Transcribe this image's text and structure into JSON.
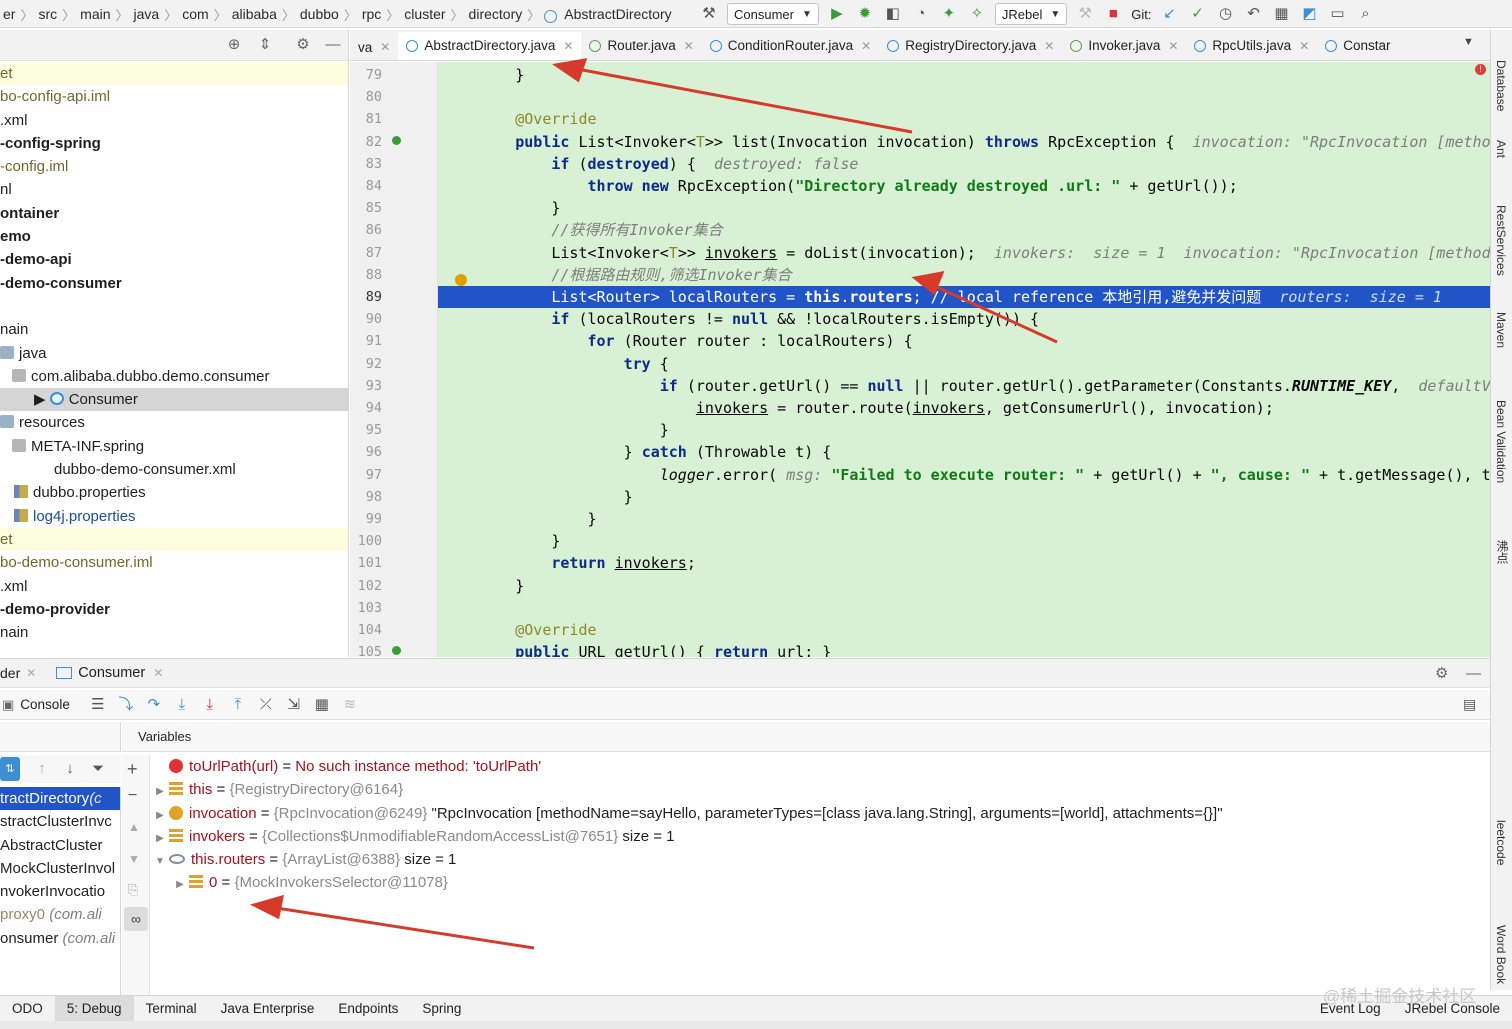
{
  "breadcrumbs": [
    "er",
    "src",
    "main",
    "java",
    "com",
    "alibaba",
    "dubbo",
    "rpc",
    "cluster",
    "directory",
    "AbstractDirectory"
  ],
  "toolbar": {
    "run_config": "Consumer",
    "jrebel": "JRebel",
    "git_label": "Git:"
  },
  "project_tree": [
    {
      "label": "et",
      "style": "olive alt"
    },
    {
      "label": "bo-config-api.iml",
      "style": "olive"
    },
    {
      "label": ".xml",
      "style": ""
    },
    {
      "label": "-config-spring",
      "style": "bold"
    },
    {
      "label": "-config.iml",
      "style": "olive"
    },
    {
      "label": "nl",
      "style": ""
    },
    {
      "label": "ontainer",
      "style": "bold"
    },
    {
      "label": "emo",
      "style": "bold"
    },
    {
      "label": "-demo-api",
      "style": "bold"
    },
    {
      "label": "-demo-consumer",
      "style": "bold"
    },
    {
      "label": "",
      "style": ""
    },
    {
      "label": "nain",
      "style": ""
    },
    {
      "label": "java",
      "style": "",
      "icon": "folder",
      "indent": 0
    },
    {
      "label": "com.alibaba.dubbo.demo.consumer",
      "style": "",
      "icon": "pkg",
      "indent": 12
    },
    {
      "label": "Consumer",
      "style": "sel",
      "icon": "cls",
      "indent": 34
    },
    {
      "label": "resources",
      "style": "",
      "icon": "folder",
      "indent": 0
    },
    {
      "label": "META-INF.spring",
      "style": "",
      "icon": "pkg",
      "indent": 12
    },
    {
      "label": "dubbo-demo-consumer.xml",
      "style": "",
      "indent": 54
    },
    {
      "label": "dubbo.properties",
      "style": "",
      "icon": "prop",
      "indent": 14
    },
    {
      "label": "log4j.properties",
      "style": "blue",
      "icon": "prop",
      "indent": 14
    },
    {
      "label": "et",
      "style": "olive alt"
    },
    {
      "label": "bo-demo-consumer.iml",
      "style": "olive"
    },
    {
      "label": ".xml",
      "style": ""
    },
    {
      "label": "-demo-provider",
      "style": "bold"
    },
    {
      "label": "nain",
      "style": ""
    }
  ],
  "editor_tabs": [
    {
      "label": "va",
      "kind": "plain"
    },
    {
      "label": "AbstractDirectory.java",
      "kind": "class",
      "active": true
    },
    {
      "label": "Router.java",
      "kind": "iface"
    },
    {
      "label": "ConditionRouter.java",
      "kind": "class"
    },
    {
      "label": "RegistryDirectory.java",
      "kind": "class"
    },
    {
      "label": "Invoker.java",
      "kind": "iface"
    },
    {
      "label": "RpcUtils.java",
      "kind": "class"
    },
    {
      "label": "Constar",
      "kind": "class",
      "truncated": true
    }
  ],
  "code": {
    "first_line": 79,
    "current_line": 89,
    "lines": [
      [
        {
          "t": "        }"
        }
      ],
      [
        {
          "t": ""
        }
      ],
      [
        {
          "t": "        "
        },
        {
          "t": "@Override",
          "c": "ann"
        }
      ],
      [
        {
          "t": "        "
        },
        {
          "t": "public",
          "c": "kw"
        },
        {
          "t": " List<Invoker<"
        },
        {
          "t": "T",
          "c": "ann"
        },
        {
          "t": ">> list(Invocation invocation) "
        },
        {
          "t": "throws",
          "c": "kw"
        },
        {
          "t": " RpcException {  "
        },
        {
          "t": "invocation: \"RpcInvocation [metho",
          "c": "hint"
        }
      ],
      [
        {
          "t": "            "
        },
        {
          "t": "if",
          "c": "kw"
        },
        {
          "t": " ("
        },
        {
          "t": "destroyed",
          "c": "kw"
        },
        {
          "t": ") {  "
        },
        {
          "t": "destroyed: false",
          "c": "hint"
        }
      ],
      [
        {
          "t": "                "
        },
        {
          "t": "throw new",
          "c": "kw"
        },
        {
          "t": " RpcException("
        },
        {
          "t": "\"Directory already destroyed .url: \"",
          "c": "str"
        },
        {
          "t": " + getUrl());"
        }
      ],
      [
        {
          "t": "            }"
        }
      ],
      [
        {
          "t": "            "
        },
        {
          "t": "//获得所有Invoker集合",
          "c": "cmt"
        }
      ],
      [
        {
          "t": "            List<Invoker<"
        },
        {
          "t": "T",
          "c": "ann"
        },
        {
          "t": ">> "
        },
        {
          "t": "invokers",
          "c": "ul"
        },
        {
          "t": " = doList(invocation);  "
        },
        {
          "t": "invokers:  size = 1  invocation: \"RpcInvocation [method",
          "c": "hint"
        }
      ],
      [
        {
          "t": "            "
        },
        {
          "t": "//根据路由规则,筛选Invoker集合",
          "c": "cmt"
        }
      ],
      [
        {
          "t": "            List<Router> localRouters = "
        },
        {
          "t": "this",
          "c": "kw"
        },
        {
          "t": "."
        },
        {
          "t": "routers",
          "c": "bold"
        },
        {
          "t": "; // local reference 本地引用,避免并发问题  "
        },
        {
          "t": "routers:  size = 1",
          "c": "hint"
        }
      ],
      [
        {
          "t": "            "
        },
        {
          "t": "if",
          "c": "kw"
        },
        {
          "t": " (localRouters != "
        },
        {
          "t": "null",
          "c": "kw"
        },
        {
          "t": " && !localRouters.isEmpty()) {"
        }
      ],
      [
        {
          "t": "                "
        },
        {
          "t": "for",
          "c": "kw"
        },
        {
          "t": " (Router router : localRouters) {"
        }
      ],
      [
        {
          "t": "                    "
        },
        {
          "t": "try",
          "c": "kw"
        },
        {
          "t": " {"
        }
      ],
      [
        {
          "t": "                        "
        },
        {
          "t": "if",
          "c": "kw"
        },
        {
          "t": " (router.getUrl() == "
        },
        {
          "t": "null",
          "c": "kw"
        },
        {
          "t": " || router.getUrl().getParameter(Constants."
        },
        {
          "t": "RUNTIME_KEY",
          "c": "ital bold"
        },
        {
          "t": ",  "
        },
        {
          "t": "defaultValu",
          "c": "hint"
        }
      ],
      [
        {
          "t": "                            "
        },
        {
          "t": "invokers",
          "c": "ul"
        },
        {
          "t": " = router.route("
        },
        {
          "t": "invokers",
          "c": "ul"
        },
        {
          "t": ", getConsumerUrl(), invocation);"
        }
      ],
      [
        {
          "t": "                        }"
        }
      ],
      [
        {
          "t": "                    } "
        },
        {
          "t": "catch",
          "c": "kw"
        },
        {
          "t": " (Throwable t) {"
        }
      ],
      [
        {
          "t": "                        "
        },
        {
          "t": "logger",
          "c": "ital"
        },
        {
          "t": ".error( "
        },
        {
          "t": "msg:",
          "c": "hint"
        },
        {
          "t": " "
        },
        {
          "t": "\"Failed to execute router: \"",
          "c": "str"
        },
        {
          "t": " + getUrl() + "
        },
        {
          "t": "\", cause: \"",
          "c": "str"
        },
        {
          "t": " + t.getMessage(), t)"
        }
      ],
      [
        {
          "t": "                    }"
        }
      ],
      [
        {
          "t": "                }"
        }
      ],
      [
        {
          "t": "            }"
        }
      ],
      [
        {
          "t": "            "
        },
        {
          "t": "return",
          "c": "kw"
        },
        {
          "t": " "
        },
        {
          "t": "invokers",
          "c": "ul"
        },
        {
          "t": ";"
        }
      ],
      [
        {
          "t": "        }"
        }
      ],
      [
        {
          "t": ""
        }
      ],
      [
        {
          "t": "        "
        },
        {
          "t": "@Override",
          "c": "ann"
        }
      ],
      [
        {
          "t": "        "
        },
        {
          "t": "public",
          "c": "kw"
        },
        {
          "t": " URL getUrl() { "
        },
        {
          "t": "return",
          "c": "kw"
        },
        {
          "t": " url; }"
        }
      ]
    ]
  },
  "right_tools": [
    "Database",
    "Ant",
    "RestServices",
    "Maven",
    "Bean Validation",
    "沸点"
  ],
  "right_tools_lower": [
    "leetcode",
    "Word Book"
  ],
  "debug": {
    "header_tab_prefix": "der",
    "session_tab": "Consumer",
    "console_label": "Console",
    "variables_title": "Variables",
    "frames": [
      {
        "name": "tractDirectory",
        "loc": "(c",
        "selected": true
      },
      {
        "name": "stractClusterInvc",
        "loc": ""
      },
      {
        "name": " AbstractCluster",
        "loc": ""
      },
      {
        "name": "MockClusterInvol",
        "loc": ""
      },
      {
        "name": "nvokerInvocatio",
        "loc": ""
      },
      {
        "name": " proxy0 ",
        "loc": "(com.ali",
        "dim": true
      },
      {
        "name": "onsumer ",
        "loc": "(com.ali"
      }
    ],
    "variables": [
      {
        "icon": "err",
        "name": "toUrlPath(url)",
        "eq": " = ",
        "type": "",
        "value": "No such instance method: 'toUrlPath'",
        "error": true,
        "expander": ""
      },
      {
        "icon": "field",
        "name": "this",
        "eq": " = ",
        "type": "{RegistryDirectory@6164}",
        "value": "",
        "expander": "▶"
      },
      {
        "icon": "param",
        "name": "invocation",
        "eq": " = ",
        "type": "{RpcInvocation@6249}",
        "value": " \"RpcInvocation [methodName=sayHello, parameterTypes=[class java.lang.String], arguments=[world], attachments={}]\"",
        "expander": "▶"
      },
      {
        "icon": "field",
        "name": "invokers",
        "eq": " = ",
        "type": "{Collections$UnmodifiableRandomAccessList@7651}",
        "value": "  size = 1",
        "expander": "▶"
      },
      {
        "icon": "watch",
        "name": "this.routers",
        "eq": " = ",
        "type": "{ArrayList@6388}",
        "value": "  size = 1",
        "expander": "▼"
      },
      {
        "icon": "field",
        "name": "0",
        "eq": " = ",
        "type": "{MockInvokersSelector@11078}",
        "value": "",
        "expander": "▶",
        "child": true
      }
    ]
  },
  "bottom_tabs": [
    {
      "label": "ODO"
    },
    {
      "label": "5: Debug",
      "active": true
    },
    {
      "label": "Terminal"
    },
    {
      "label": "Java Enterprise"
    },
    {
      "label": "Endpoints"
    },
    {
      "label": "Spring"
    }
  ],
  "bottom_right_tabs": [
    "Event Log",
    "JRebel Console"
  ],
  "watermark": "@稀土掘金技术社区",
  "colors": {
    "editor_bg": "#d8f1d4",
    "highlight": "#2154c7",
    "arrow": "#d63a2a"
  }
}
